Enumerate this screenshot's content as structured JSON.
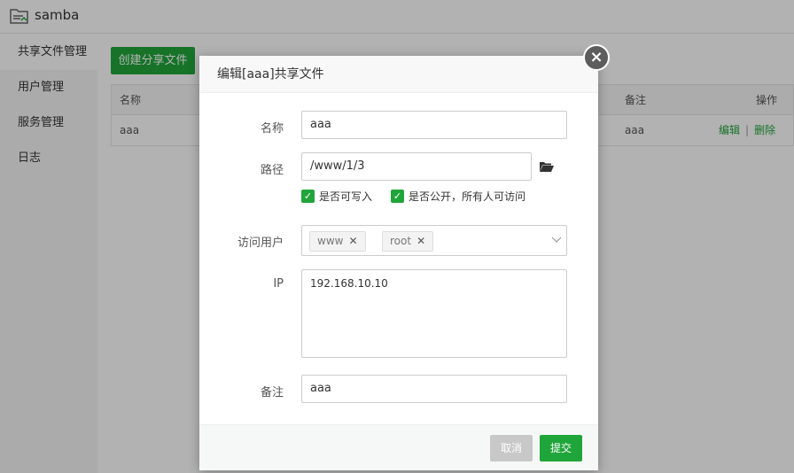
{
  "app": {
    "title": "samba"
  },
  "sidebar": {
    "items": [
      {
        "label": "共享文件管理"
      },
      {
        "label": "用户管理"
      },
      {
        "label": "服务管理"
      },
      {
        "label": "日志"
      }
    ]
  },
  "main": {
    "create_button": "创建分享文件",
    "table": {
      "headers": {
        "name": "名称",
        "remark": "备注",
        "ops": "操作"
      },
      "rows": [
        {
          "name": "aaa",
          "remark": "aaa",
          "edit": "编辑",
          "sep": "|",
          "delete": "删除"
        }
      ]
    }
  },
  "dialog": {
    "title": "编辑[aaa]共享文件",
    "close_icon": "×",
    "fields": {
      "name_label": "名称",
      "name_value": "aaa",
      "path_label": "路径",
      "path_value": "/www/1/3",
      "writable_label": "是否可写入",
      "public_label": "是否公开，所有人可访问",
      "users_label": "访问用户",
      "users": [
        {
          "name": "www"
        },
        {
          "name": "root"
        }
      ],
      "ip_label": "IP",
      "ip_value": "192.168.10.10",
      "remark_label": "备注",
      "remark_value": "aaa"
    },
    "cancel_label": "取消",
    "submit_label": "提交"
  },
  "colors": {
    "accent": "#20a53a",
    "disabled": "#c8c8c8"
  },
  "icons": {
    "folder": "folder-open-icon",
    "close": "close-icon",
    "check": "checkmark-icon",
    "chevron": "chevron-down-icon",
    "tag_remove": "x-icon",
    "app": "samba-folder-icon"
  }
}
